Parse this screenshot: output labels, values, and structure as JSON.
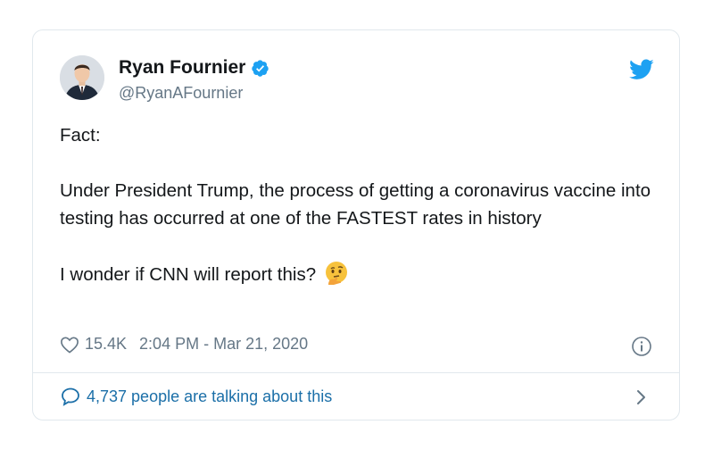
{
  "author": {
    "display_name": "Ryan Fournier",
    "handle": "@RyanAFournier",
    "verified": true,
    "avatar_icon": "profile-photo-man-in-suit"
  },
  "tweet": {
    "lines": [
      "Fact:",
      "Under President Trump, the process of getting a coronavirus vaccine into testing has occurred at one of the FASTEST rates in history",
      "I wonder if CNN will report this?"
    ],
    "emoji": "thinking-face-icon"
  },
  "meta": {
    "likes": "15.4K",
    "timestamp": "2:04 PM - Mar 21, 2020"
  },
  "footer": {
    "talking_text": "4,737 people are talking about this"
  },
  "colors": {
    "brand_blue": "#1da1f2",
    "link_blue": "#1b6fa8",
    "muted": "#657786",
    "text": "#14171a",
    "border": "#e1e8ed"
  }
}
